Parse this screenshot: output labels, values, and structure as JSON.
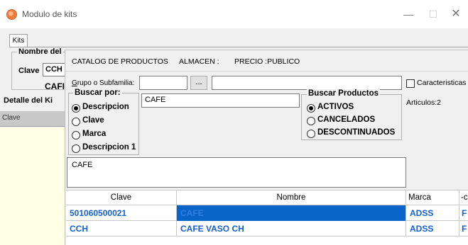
{
  "window": {
    "title": "Modulo de kits",
    "min_label": "—",
    "max_label": "☐",
    "close_label": "✕"
  },
  "outer": {
    "tab_kits": "Kits",
    "nombre_label": "Nombre del",
    "clave_label": "Clave",
    "clave_value": "CCH",
    "caf_label": "CAFI",
    "detalle_label": "Detalle del Ki",
    "left_grid_header": "Clave"
  },
  "catalog": {
    "title": "CATALOG DE PRODUCTOS",
    "almacen": "ALMACEN :",
    "precio": "PRECIO :PUBLICO",
    "grupo_label_u": "G",
    "grupo_label_rest": "rupo  o Subfamilia:",
    "dots_button": "...",
    "caracteristicas_label": "Caracteristicas",
    "caracteristicas_checked": false,
    "buscar_por": {
      "label": "Buscar por:",
      "options": [
        "Descripcion",
        "Clave",
        "Marca",
        "Descripcion 1"
      ],
      "selected": "Descripcion"
    },
    "search_value": "CAFE",
    "buscar_productos": {
      "label": "Buscar Productos",
      "options": [
        "ACTIVOS",
        "CANCELADOS",
        "DESCONTINUADOS"
      ],
      "selected": "ACTIVOS"
    },
    "articulos": "Articulos:2",
    "text_area_value": "CAFE"
  },
  "grid": {
    "columns": [
      "Clave",
      "Nombre",
      "Marca",
      "-c"
    ],
    "rows": [
      {
        "clave": "501060500021",
        "nombre": "CAFE",
        "marca": "ADSS",
        "extra": "F"
      },
      {
        "clave": "CCH",
        "nombre": "CAFE VASO CH",
        "marca": "ADSS",
        "extra": "F"
      }
    ]
  },
  "colors": {
    "selection": "#0a64c8",
    "grid_text": "#1560d4",
    "left_grid_bg": "#ffffe6"
  }
}
